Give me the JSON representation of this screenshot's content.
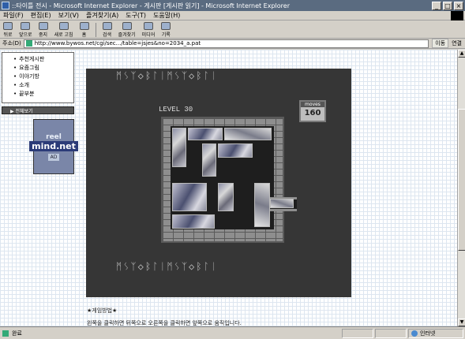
{
  "window": {
    "title": "::타이틀 전시 - Microsoft Internet Explorer - 게시판 [게시판 읽기] - Microsoft Internet Explorer",
    "buttons": [
      "_",
      "□",
      "×"
    ]
  },
  "menu": [
    "파일(F)",
    "편집(E)",
    "보기(V)",
    "즐겨찾기(A)",
    "도구(T)",
    "도움말(H)"
  ],
  "toolbar": [
    {
      "label": "뒤로",
      "icon": "back-icon"
    },
    {
      "label": "앞으로",
      "icon": "forward-icon"
    },
    {
      "label": "중지",
      "icon": "stop-icon"
    },
    {
      "label": "새로 고침",
      "icon": "refresh-icon"
    },
    {
      "label": "홈",
      "icon": "home-icon"
    },
    {
      "label": "검색",
      "icon": "search-icon"
    },
    {
      "label": "즐겨찾기",
      "icon": "favorites-icon"
    },
    {
      "label": "미디어",
      "icon": "media-icon"
    },
    {
      "label": "기록",
      "icon": "history-icon"
    }
  ],
  "address": {
    "label": "주소(D)",
    "value": "http://www.bywos.net/cgi/sec.../table=jsjes&no=2034_a.pat",
    "go": "이동",
    "links": "연결"
  },
  "sidebar": {
    "items": [
      "추천게시판",
      "요즘그림",
      "이야기방",
      "소개",
      "끝부분"
    ],
    "button": "▶ 전체보기",
    "banner": {
      "line1": "reel",
      "line2": "mind.net",
      "line3": "AD"
    }
  },
  "game": {
    "title": "LEVEL 30",
    "moves_label": "moves",
    "moves_value": "160",
    "deco_top": "ᛗᛊᛉ◇ᛒᛚᛁᛗᛊᛉ◇ᛒᛚᛁ",
    "deco_bottom": "ᛗᛊᛉ◇ᛒᛚᛁᛗᛊᛉ◇ᛒᛚᛁ"
  },
  "content": {
    "heading": "★게임방법★",
    "body": "왼쪽을 클릭하면 뒤쪽으로 오른쪽을 클릭하면 앞쪽으로 움직입니다."
  },
  "status": {
    "text": "완료",
    "zone": "인터넷"
  }
}
